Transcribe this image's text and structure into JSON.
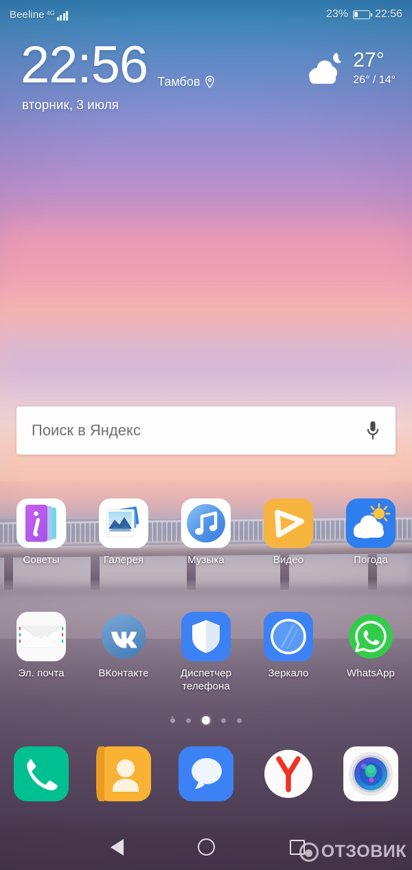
{
  "status_bar": {
    "carrier": "Beeline",
    "network_type": "4G",
    "signal_icon": "signal-bars-icon",
    "battery_percent": "23%",
    "battery_level": 23,
    "battery_icon": "battery-icon",
    "time": "22:56"
  },
  "clock_widget": {
    "time": "22:56",
    "city": "Тамбов",
    "location_icon": "location-pin-icon",
    "date": "вторник, 3 июля",
    "weather": {
      "icon": "cloud-moon-icon",
      "current_temp": "27°",
      "range": "26° / 14°"
    }
  },
  "search": {
    "placeholder": "Поиск в Яндекс",
    "mic_icon": "microphone-icon"
  },
  "app_rows": [
    {
      "apps": [
        {
          "label": "Советы",
          "icon": "tips-icon"
        },
        {
          "label": "Галерея",
          "icon": "gallery-icon"
        },
        {
          "label": "Музыка",
          "icon": "music-icon"
        },
        {
          "label": "Видео",
          "icon": "video-icon"
        },
        {
          "label": "Погода",
          "icon": "weather-icon"
        }
      ]
    },
    {
      "apps": [
        {
          "label": "Эл. почта",
          "icon": "email-icon"
        },
        {
          "label": "ВКонтакте",
          "icon": "vk-icon"
        },
        {
          "label": "Диспетчер телефона",
          "icon": "phone-manager-icon"
        },
        {
          "label": "Зеркало",
          "icon": "mirror-icon"
        },
        {
          "label": "WhatsApp",
          "icon": "whatsapp-icon"
        }
      ]
    }
  ],
  "page_indicator": {
    "total": 5,
    "active_index": 2
  },
  "dock": {
    "apps": [
      {
        "name": "phone",
        "icon": "phone-handset-icon"
      },
      {
        "name": "contacts",
        "icon": "contacts-person-icon"
      },
      {
        "name": "messages",
        "icon": "message-bubble-icon"
      },
      {
        "name": "yandex-browser",
        "icon": "yandex-y-icon"
      },
      {
        "name": "camera",
        "icon": "camera-lens-icon"
      }
    ]
  },
  "nav_bar": {
    "back_icon": "back-triangle-icon",
    "home_icon": "home-circle-icon",
    "recents_icon": "recents-square-icon"
  },
  "watermark": {
    "text": "ОТЗОВИК",
    "logo_icon": "otzovik-logo-icon"
  },
  "colors": {
    "accent_blue": "#3d82f5",
    "whatsapp_green": "#2ecc4a",
    "phone_green": "#00bf91",
    "contacts_orange": "#f9b233",
    "yandex_red": "#f03225",
    "video_amber": "#f7b githubusercontent"
  }
}
